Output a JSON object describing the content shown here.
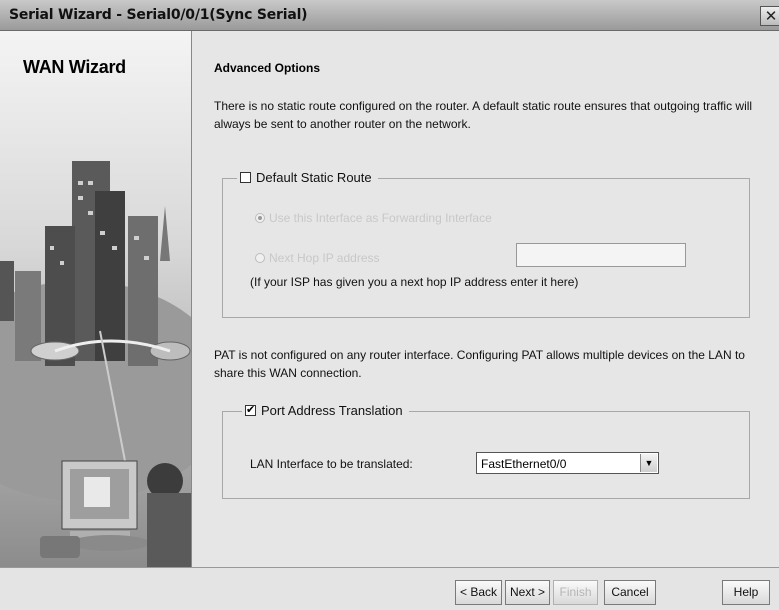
{
  "window": {
    "title": "Serial Wizard - Serial0/0/1(Sync Serial)"
  },
  "sidebar": {
    "wizard_title": "WAN Wizard"
  },
  "main": {
    "section_title": "Advanced Options",
    "static_route_info": "There is no static route configured on the router. A default static route ensures that outgoing traffic will always be sent to another router on the network.",
    "default_static_route": {
      "label": "Default Static Route",
      "checked": false,
      "use_interface_label": "Use this Interface as Forwarding Interface",
      "use_interface_selected": true,
      "next_hop_label": "Next Hop IP address",
      "next_hop_selected": false,
      "next_hop_value": "",
      "hint": "(If your ISP has given you a next hop IP address enter it here)"
    },
    "pat_info": "PAT is not configured on any router interface. Configuring PAT allows multiple devices on the LAN to share this WAN connection.",
    "pat": {
      "label": "Port Address Translation",
      "checked": true,
      "lan_interface_label": "LAN Interface to be translated:",
      "lan_interface_value": "FastEthernet0/0"
    }
  },
  "buttons": {
    "back": "< Back",
    "next": "Next >",
    "finish": "Finish",
    "cancel": "Cancel",
    "help": "Help"
  }
}
